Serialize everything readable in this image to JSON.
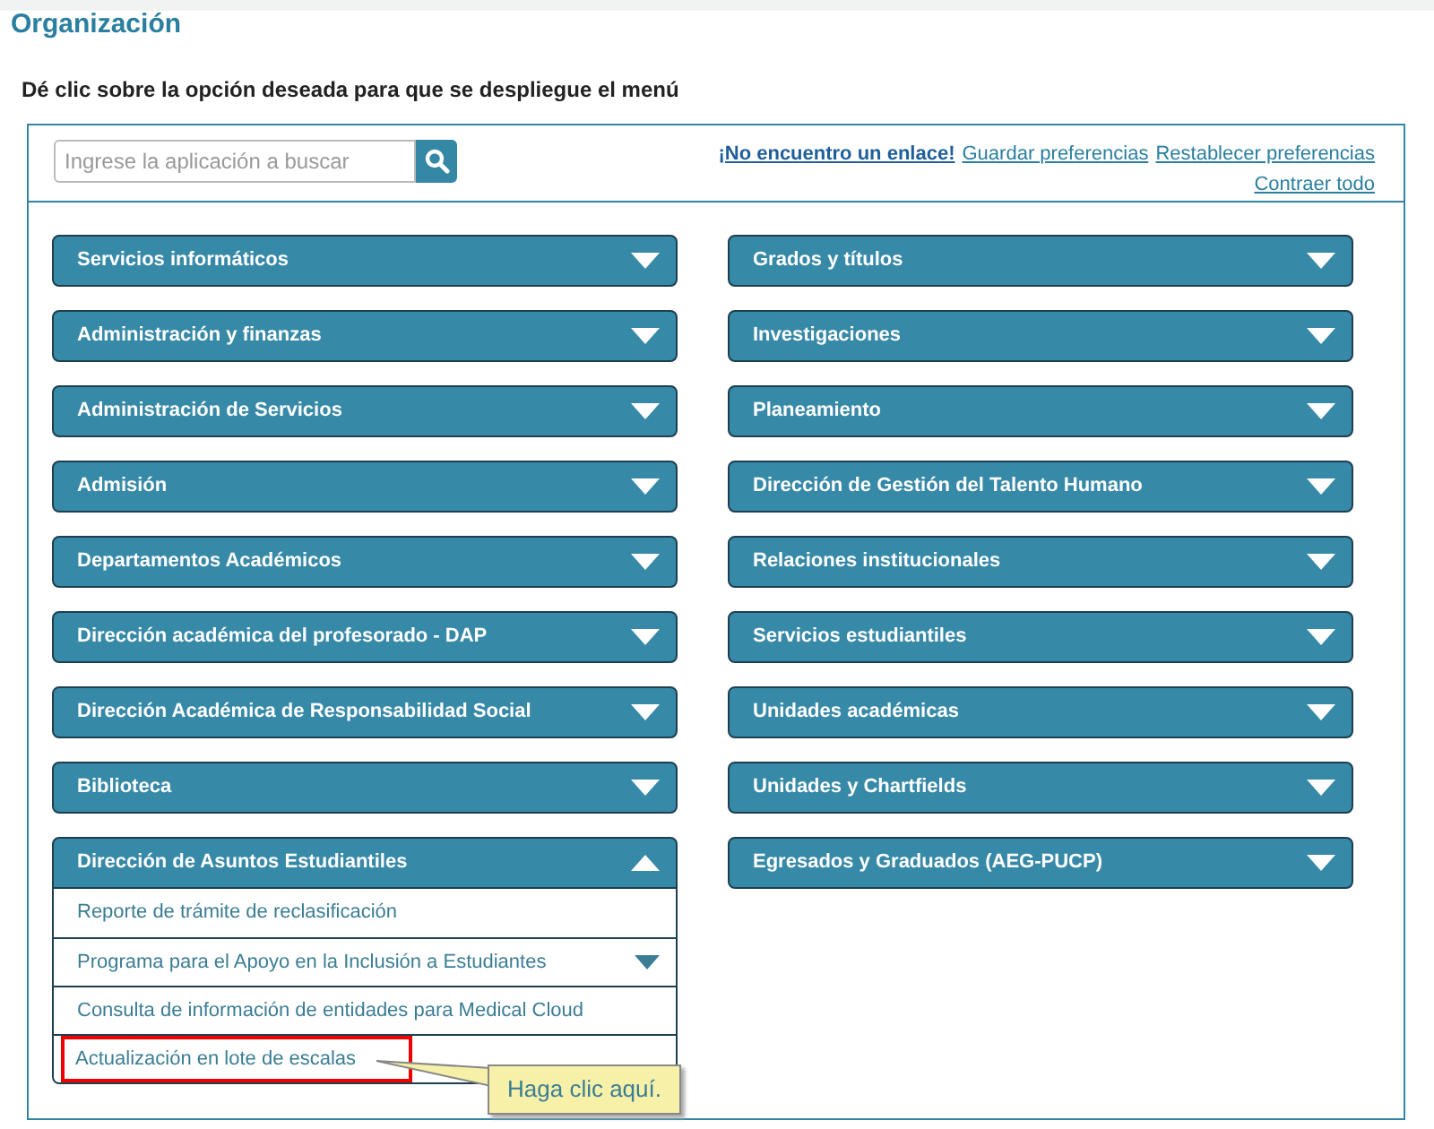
{
  "title": "Organización",
  "instruction": "Dé clic sobre la opción deseada para que se despliegue el menú",
  "search": {
    "placeholder": "Ingrese la aplicación a buscar"
  },
  "links": [
    {
      "label": "¡No encuentro un enlace!",
      "kind": "strong"
    },
    {
      "label": "Guardar preferencias",
      "kind": "plain"
    },
    {
      "label": "Restablecer preferencias",
      "kind": "plain"
    },
    {
      "label": "Contraer todo",
      "kind": "plain"
    }
  ],
  "columns": [
    [
      {
        "label": "Servicios informáticos",
        "expanded": false
      },
      {
        "label": "Administración y finanzas",
        "expanded": false
      },
      {
        "label": "Administración de Servicios",
        "expanded": false
      },
      {
        "label": "Admisión",
        "expanded": false
      },
      {
        "label": "Departamentos Académicos",
        "expanded": false
      },
      {
        "label": "Dirección académica del profesorado - DAP",
        "expanded": false
      },
      {
        "label": "Dirección Académica de Responsabilidad Social",
        "expanded": false
      },
      {
        "label": "Biblioteca",
        "expanded": false
      },
      {
        "label": "Dirección de Asuntos Estudiantiles",
        "expanded": true,
        "children": [
          {
            "label": "Reporte de trámite de reclasificación",
            "kind": "link",
            "highlighted": false
          },
          {
            "label": "Programa para el Apoyo en la Inclusión a Estudiantes",
            "kind": "submenu",
            "expanded": false,
            "highlighted": false
          },
          {
            "label": "Consulta de información de entidades para Medical Cloud",
            "kind": "link",
            "highlighted": false
          },
          {
            "label": "Actualización en lote de escalas",
            "kind": "link",
            "highlighted": true,
            "tooltip": "Haga clic aquí."
          }
        ]
      }
    ],
    [
      {
        "label": "Grados y títulos",
        "expanded": false
      },
      {
        "label": "Investigaciones",
        "expanded": false
      },
      {
        "label": "Planeamiento",
        "expanded": false
      },
      {
        "label": "Dirección de Gestión del Talento Humano",
        "expanded": false
      },
      {
        "label": "Relaciones institucionales",
        "expanded": false
      },
      {
        "label": "Servicios estudiantiles",
        "expanded": false
      },
      {
        "label": "Unidades académicas",
        "expanded": false
      },
      {
        "label": "Unidades y Chartfields",
        "expanded": false
      },
      {
        "label": "Egresados y Graduados (AEG-PUCP)",
        "expanded": false
      }
    ]
  ]
}
